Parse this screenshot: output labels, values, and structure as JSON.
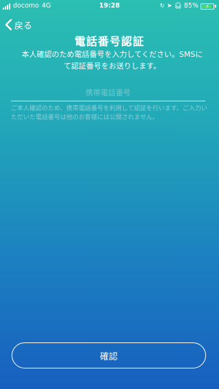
{
  "status_bar": {
    "carrier": "docomo",
    "network": "4G",
    "time": "19:28",
    "icons": [
      "screen-lock-icon",
      "location-arrow-icon",
      "headphones-icon"
    ],
    "battery_text": "85%",
    "battery_level": 0.85,
    "charging": true,
    "battery_color": "#4cd964"
  },
  "nav": {
    "back_label": "戻る"
  },
  "page": {
    "title": "電話番号認証",
    "description": "本人確認のため電話番号を入力してください。SMSにて認証番号をお送りします。"
  },
  "phone_input": {
    "placeholder": "携帯電話番号",
    "value": ""
  },
  "notice": "ご本人確認のため、携帯電話番号を利用して認証を行います。ご入力いただいた電話番号は他のお客様には公開されません。",
  "confirm_button": {
    "label": "確認"
  },
  "colors": {
    "gradient_top": "#2bbfb2",
    "gradient_bottom": "#175fbf",
    "text": "#ffffff"
  }
}
